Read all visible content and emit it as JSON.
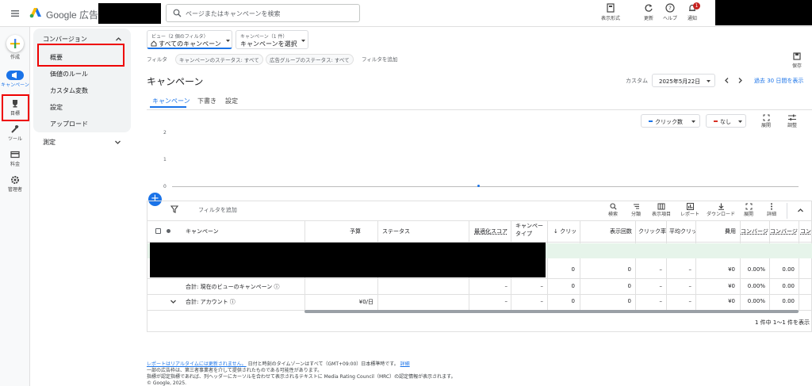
{
  "topbar": {
    "brand": "Google 広告",
    "search_placeholder": "ページまたはキャンペーンを検索",
    "actions": [
      {
        "label": "表示形式",
        "icon": "view-format-icon"
      },
      {
        "label": "更新",
        "icon": "refresh-icon"
      },
      {
        "label": "ヘルプ",
        "icon": "help-icon"
      },
      {
        "label": "通知",
        "icon": "bell-icon",
        "badge": "1"
      }
    ]
  },
  "rail": [
    {
      "label": "作成",
      "icon": "plus-icon"
    },
    {
      "label": "キャンペーン",
      "icon": "megaphone-icon"
    },
    {
      "label": "目標",
      "icon": "trophy-icon"
    },
    {
      "label": "ツール",
      "icon": "tools-icon"
    },
    {
      "label": "料金",
      "icon": "billing-icon"
    },
    {
      "label": "管理者",
      "icon": "admin-gear-icon"
    }
  ],
  "nav": {
    "section": "コンバージョン",
    "items": [
      "概要",
      "価値のルール",
      "カスタム変数",
      "設定",
      "アップロード"
    ],
    "section2": "測定"
  },
  "filters": {
    "view_small": "ビュー（2 個のフィルタ）",
    "view_value": "すべてのキャンペーン",
    "campaign_small": "キャンペーン（1 件）",
    "campaign_value": "キャンペーンを選択",
    "filter_label": "フィルタ",
    "chips": [
      "キャンペーンのステータス: すべて",
      "広告グループのステータス: すべて"
    ],
    "add_filter": "フィルタを追加",
    "save": "保存"
  },
  "page": {
    "title": "キャンペーン",
    "custom": "カスタム",
    "date": "2025年5月22日",
    "show_30": "過去 30 日間を表示",
    "tabs": [
      "キャンペーン",
      "下書き",
      "設定"
    ]
  },
  "chart": {
    "metric1": "クリック数",
    "metric2": "なし",
    "expand": "展開",
    "adjust": "調整",
    "y_ticks": [
      "2",
      "1",
      "0"
    ]
  },
  "table_toolbar": {
    "add_filter": "フィルタを追加",
    "icons": [
      {
        "label": "検索",
        "icon": "search-icon"
      },
      {
        "label": "分類",
        "icon": "segment-icon"
      },
      {
        "label": "表示項目",
        "icon": "columns-icon"
      },
      {
        "label": "レポート",
        "icon": "report-icon"
      },
      {
        "label": "ダウンロード",
        "icon": "download-icon"
      },
      {
        "label": "展開",
        "icon": "expand-icon"
      },
      {
        "label": "詳細",
        "icon": "more-icon"
      }
    ]
  },
  "table": {
    "headers": {
      "campaign": "キャンペーン",
      "budget": "予算",
      "status": "ステータス",
      "opt_score": "最適化スコア",
      "type_1": "キャンペー",
      "type_2": "タイプ",
      "clicks": "↓ クリッ",
      "impressions": "表示回数",
      "ctr": "クリック率",
      "avg_cpc": "平均クリッ",
      "cost": "費用",
      "conv1": "コンバージ",
      "conv2": "コンバージ",
      "conv3": "コン"
    },
    "rows": [
      {
        "label": "",
        "budget": "",
        "opt": "",
        "type": "",
        "clicks": "0",
        "impr": "0",
        "ctr": "–",
        "cpc": "–",
        "cost": "¥0",
        "c1": "0.00%",
        "c2": "0.00"
      },
      {
        "label": "合計: 現在のビューのキャンペーン ⓘ",
        "budget": "",
        "opt": "–",
        "type": "–",
        "clicks": "0",
        "impr": "0",
        "ctr": "–",
        "cpc": "–",
        "cost": "¥0",
        "c1": "0.00%",
        "c2": "0.00"
      },
      {
        "label": "合計: アカウント ⓘ",
        "budget": "¥0/日",
        "opt": "–",
        "type": "–",
        "clicks": "0",
        "impr": "0",
        "ctr": "–",
        "cpc": "–",
        "cost": "¥0",
        "c1": "0.00%",
        "c2": "0.00"
      }
    ],
    "pagination": "1 件中 1～1 件を表示"
  },
  "footer": {
    "link": "レポートはリアルタイムには更新されません。",
    "line1": "日付と時刻のタイムゾーンはすべて（GMT+09:00）日本標準時です。",
    "detail": "詳細",
    "line2": "一部の広告枠は、第三者事業者を介して提供されたものである可能性があります。",
    "line3": "指標が認定指標であれば、列ヘッダーにカーソルを合わせて表示されるテキストに Media Rating Council（MRC）の認定情報が表示されます。",
    "copyright": "© Google, 2025."
  }
}
